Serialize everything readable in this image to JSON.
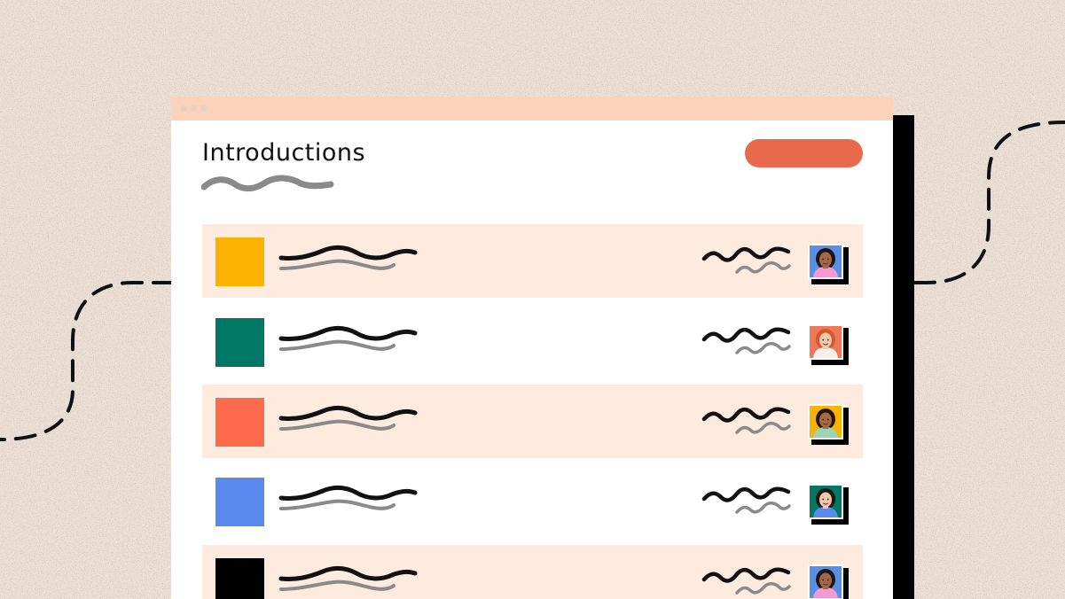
{
  "page": {
    "title": "Introductions",
    "background_color": "#ecdfd6",
    "accent_color": "#e9694c",
    "titlebar_color": "#fcd3b8",
    "row_shade_color": "#fdebe0"
  },
  "rows": [
    {
      "swatch_color": "#fbb300",
      "avatar_icon": "avatar-woman-curly-hair-icon",
      "avatar_bg": "#5a8fe6",
      "skin": "#a4674a",
      "hair": "#1f1614",
      "shirt": "#f39ad4"
    },
    {
      "swatch_color": "#007864",
      "avatar_icon": "avatar-woman-red-hair-icon",
      "avatar_bg": "#f0775a",
      "skin": "#f1c7ad",
      "hair": "#d35a2c",
      "shirt": "#f4f1ec"
    },
    {
      "swatch_color": "#ff6a4a",
      "avatar_icon": "avatar-man-glasses-icon",
      "avatar_bg": "#fbb300",
      "skin": "#a86a42",
      "hair": "#201614",
      "shirt": "#9ad6b4"
    },
    {
      "swatch_color": "#5a8aee",
      "avatar_icon": "avatar-woman-bun-hair-icon",
      "avatar_bg": "#007864",
      "skin": "#f1c7ad",
      "hair": "#1f1614",
      "shirt": "#5a8aee"
    },
    {
      "swatch_color": "#000000",
      "avatar_icon": "avatar-woman-curly-hair-icon",
      "avatar_bg": "#5a8fe6",
      "skin": "#a4674a",
      "hair": "#1f1614",
      "shirt": "#f39ad4"
    }
  ]
}
